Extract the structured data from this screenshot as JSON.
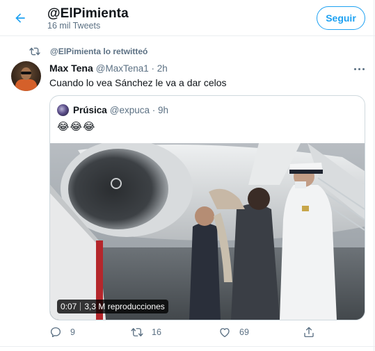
{
  "header": {
    "title": "@ElPimienta",
    "subtitle": "16 mil Tweets",
    "follow_label": "Seguir",
    "back_icon": "arrow-left-icon"
  },
  "retweet_context": {
    "text": "@ElPimienta lo retwitteó",
    "icon": "retweet-icon"
  },
  "tweet": {
    "name": "Max Tena",
    "handle": "@MaxTena1 · 2h",
    "text": "Cuando lo vea Sánchez le va a dar celos",
    "more_icon": "more-horizontal-icon",
    "actions": {
      "replies": "9",
      "retweets": "16",
      "likes": "69"
    }
  },
  "quoted": {
    "name": "Prúsica",
    "handle": "@expuca · 9h",
    "text": "😂😂😂",
    "video": {
      "duration": "0:07",
      "views": "3,3 M reproducciones"
    }
  },
  "colors": {
    "accent": "#1da1f2",
    "secondary_text": "#5b7083",
    "border": "#cfd9de"
  }
}
